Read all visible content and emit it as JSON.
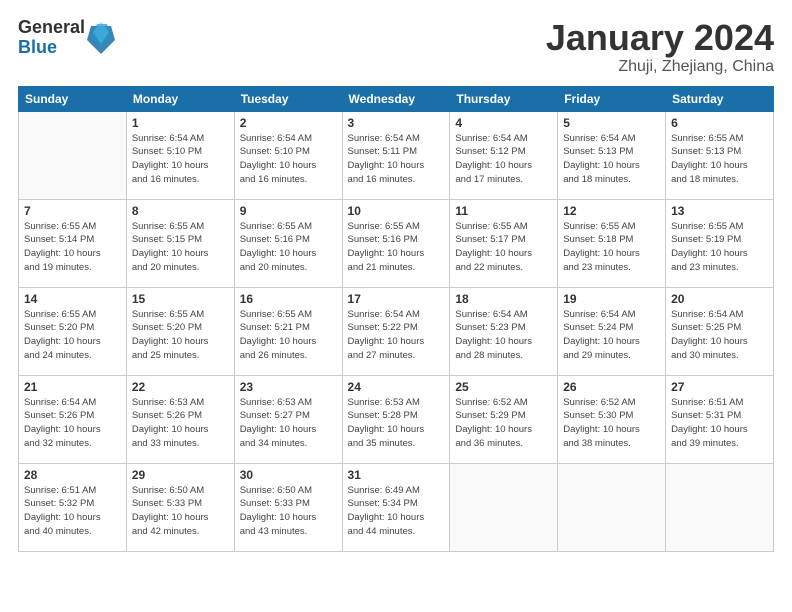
{
  "header": {
    "logo_general": "General",
    "logo_blue": "Blue",
    "title": "January 2024",
    "location": "Zhuji, Zhejiang, China"
  },
  "columns": [
    "Sunday",
    "Monday",
    "Tuesday",
    "Wednesday",
    "Thursday",
    "Friday",
    "Saturday"
  ],
  "weeks": [
    [
      {
        "day": "",
        "info": ""
      },
      {
        "day": "1",
        "info": "Sunrise: 6:54 AM\nSunset: 5:10 PM\nDaylight: 10 hours\nand 16 minutes."
      },
      {
        "day": "2",
        "info": "Sunrise: 6:54 AM\nSunset: 5:10 PM\nDaylight: 10 hours\nand 16 minutes."
      },
      {
        "day": "3",
        "info": "Sunrise: 6:54 AM\nSunset: 5:11 PM\nDaylight: 10 hours\nand 16 minutes."
      },
      {
        "day": "4",
        "info": "Sunrise: 6:54 AM\nSunset: 5:12 PM\nDaylight: 10 hours\nand 17 minutes."
      },
      {
        "day": "5",
        "info": "Sunrise: 6:54 AM\nSunset: 5:13 PM\nDaylight: 10 hours\nand 18 minutes."
      },
      {
        "day": "6",
        "info": "Sunrise: 6:55 AM\nSunset: 5:13 PM\nDaylight: 10 hours\nand 18 minutes."
      }
    ],
    [
      {
        "day": "7",
        "info": "Sunrise: 6:55 AM\nSunset: 5:14 PM\nDaylight: 10 hours\nand 19 minutes."
      },
      {
        "day": "8",
        "info": "Sunrise: 6:55 AM\nSunset: 5:15 PM\nDaylight: 10 hours\nand 20 minutes."
      },
      {
        "day": "9",
        "info": "Sunrise: 6:55 AM\nSunset: 5:16 PM\nDaylight: 10 hours\nand 20 minutes."
      },
      {
        "day": "10",
        "info": "Sunrise: 6:55 AM\nSunset: 5:16 PM\nDaylight: 10 hours\nand 21 minutes."
      },
      {
        "day": "11",
        "info": "Sunrise: 6:55 AM\nSunset: 5:17 PM\nDaylight: 10 hours\nand 22 minutes."
      },
      {
        "day": "12",
        "info": "Sunrise: 6:55 AM\nSunset: 5:18 PM\nDaylight: 10 hours\nand 23 minutes."
      },
      {
        "day": "13",
        "info": "Sunrise: 6:55 AM\nSunset: 5:19 PM\nDaylight: 10 hours\nand 23 minutes."
      }
    ],
    [
      {
        "day": "14",
        "info": "Sunrise: 6:55 AM\nSunset: 5:20 PM\nDaylight: 10 hours\nand 24 minutes."
      },
      {
        "day": "15",
        "info": "Sunrise: 6:55 AM\nSunset: 5:20 PM\nDaylight: 10 hours\nand 25 minutes."
      },
      {
        "day": "16",
        "info": "Sunrise: 6:55 AM\nSunset: 5:21 PM\nDaylight: 10 hours\nand 26 minutes."
      },
      {
        "day": "17",
        "info": "Sunrise: 6:54 AM\nSunset: 5:22 PM\nDaylight: 10 hours\nand 27 minutes."
      },
      {
        "day": "18",
        "info": "Sunrise: 6:54 AM\nSunset: 5:23 PM\nDaylight: 10 hours\nand 28 minutes."
      },
      {
        "day": "19",
        "info": "Sunrise: 6:54 AM\nSunset: 5:24 PM\nDaylight: 10 hours\nand 29 minutes."
      },
      {
        "day": "20",
        "info": "Sunrise: 6:54 AM\nSunset: 5:25 PM\nDaylight: 10 hours\nand 30 minutes."
      }
    ],
    [
      {
        "day": "21",
        "info": "Sunrise: 6:54 AM\nSunset: 5:26 PM\nDaylight: 10 hours\nand 32 minutes."
      },
      {
        "day": "22",
        "info": "Sunrise: 6:53 AM\nSunset: 5:26 PM\nDaylight: 10 hours\nand 33 minutes."
      },
      {
        "day": "23",
        "info": "Sunrise: 6:53 AM\nSunset: 5:27 PM\nDaylight: 10 hours\nand 34 minutes."
      },
      {
        "day": "24",
        "info": "Sunrise: 6:53 AM\nSunset: 5:28 PM\nDaylight: 10 hours\nand 35 minutes."
      },
      {
        "day": "25",
        "info": "Sunrise: 6:52 AM\nSunset: 5:29 PM\nDaylight: 10 hours\nand 36 minutes."
      },
      {
        "day": "26",
        "info": "Sunrise: 6:52 AM\nSunset: 5:30 PM\nDaylight: 10 hours\nand 38 minutes."
      },
      {
        "day": "27",
        "info": "Sunrise: 6:51 AM\nSunset: 5:31 PM\nDaylight: 10 hours\nand 39 minutes."
      }
    ],
    [
      {
        "day": "28",
        "info": "Sunrise: 6:51 AM\nSunset: 5:32 PM\nDaylight: 10 hours\nand 40 minutes."
      },
      {
        "day": "29",
        "info": "Sunrise: 6:50 AM\nSunset: 5:33 PM\nDaylight: 10 hours\nand 42 minutes."
      },
      {
        "day": "30",
        "info": "Sunrise: 6:50 AM\nSunset: 5:33 PM\nDaylight: 10 hours\nand 43 minutes."
      },
      {
        "day": "31",
        "info": "Sunrise: 6:49 AM\nSunset: 5:34 PM\nDaylight: 10 hours\nand 44 minutes."
      },
      {
        "day": "",
        "info": ""
      },
      {
        "day": "",
        "info": ""
      },
      {
        "day": "",
        "info": ""
      }
    ]
  ]
}
